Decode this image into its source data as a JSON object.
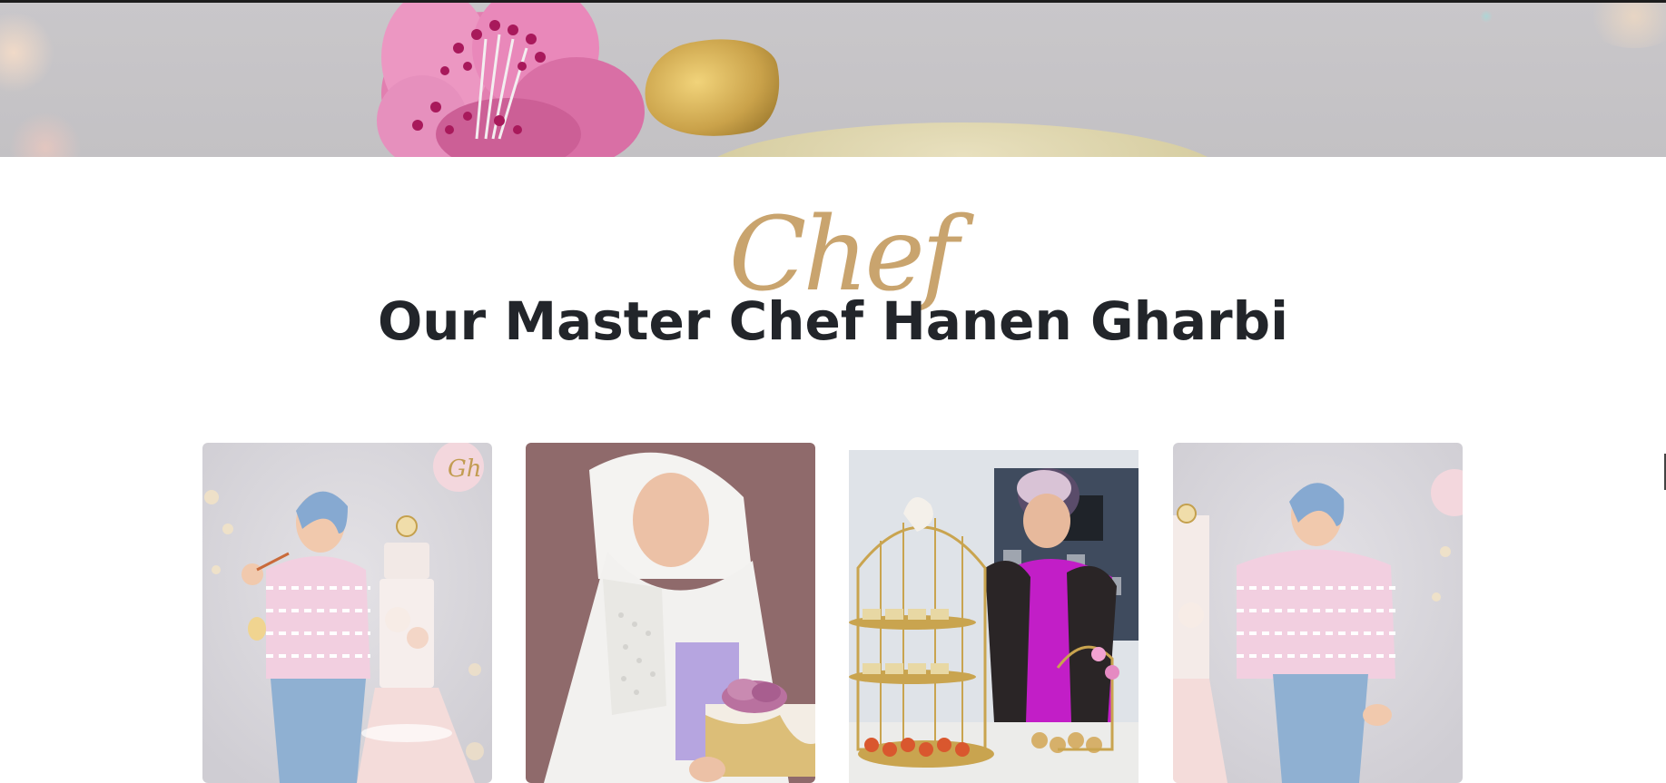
{
  "hero": {
    "image_subject": "pink sugar flower on cake with gold leaf"
  },
  "heading": {
    "script_text": "Chef",
    "title": "Our Master Chef Hanen Gharbi"
  },
  "gallery": {
    "cards": [
      {
        "subject": "chef-with-tiered-cake"
      },
      {
        "subject": "chef-in-white-hijab-with-cake"
      },
      {
        "subject": "chef-with-pastry-stands"
      },
      {
        "subject": "chef-portrait-pink-shirt"
      }
    ]
  },
  "logo": {
    "text": "Gh"
  },
  "colors": {
    "accent_gold": "#c9a46e",
    "title_dark": "#22252a",
    "hero_bg": "#c6c4c7"
  }
}
